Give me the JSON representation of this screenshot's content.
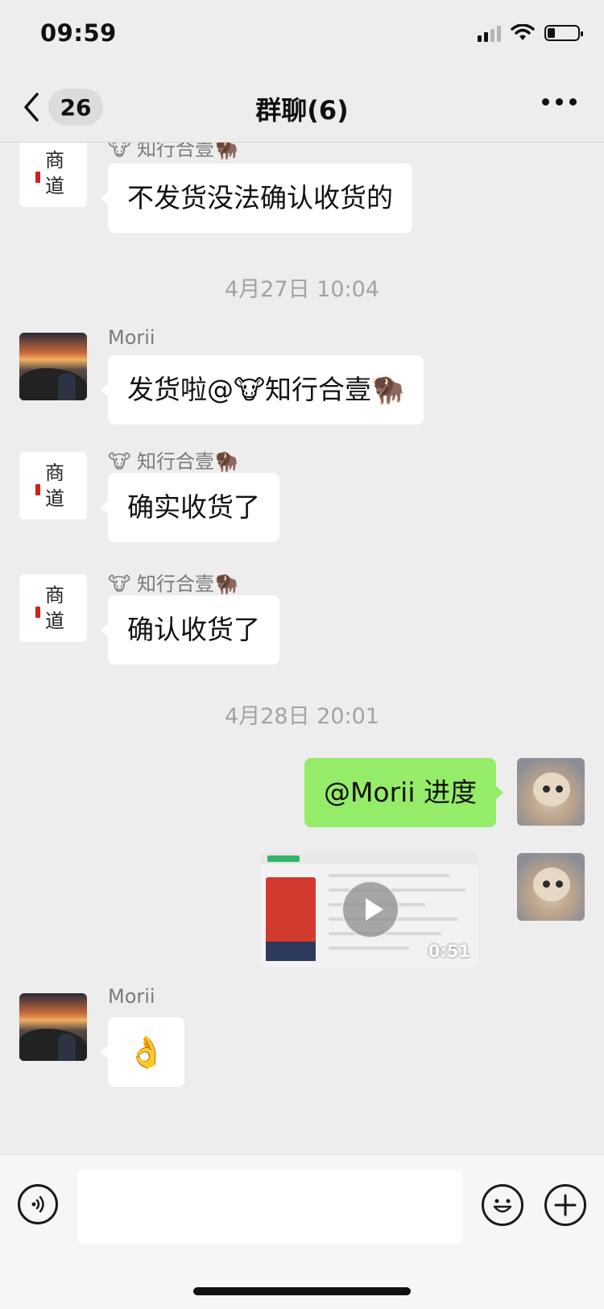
{
  "status_bar": {
    "time": "09:59",
    "battery_level": 0.25,
    "signal_bars": 2
  },
  "nav": {
    "back_badge": "26",
    "title": "群聊(6)"
  },
  "chat": {
    "messages": [
      {
        "sender": "🐮 知行合壹🦬",
        "text": "不发货没法确认收货的"
      },
      {
        "timestamp": "4月27日 10:04"
      },
      {
        "sender": "Morii",
        "text": "发货啦@🐮知行合壹🦬"
      },
      {
        "sender": "🐮 知行合壹🦬",
        "text": "确实收货了"
      },
      {
        "sender": "🐮 知行合壹🦬",
        "text": "确认收货了"
      },
      {
        "timestamp": "4月28日 20:01"
      },
      {
        "text": "@Morii 进度"
      },
      {
        "video_duration": "0:51"
      },
      {
        "sender": "Morii",
        "text": "👌"
      }
    ],
    "avatar_logo_text": "商道"
  },
  "input_bar": {
    "message_value": "",
    "placeholder": ""
  },
  "colors": {
    "self_bubble": "#95ec69",
    "other_bubble": "#ffffff",
    "background": "#ededed"
  },
  "icons": {
    "back": "chevron-left-icon",
    "more": "more-dots-icon",
    "voice": "voice-icon",
    "emoji": "emoji-icon",
    "plus": "plus-icon",
    "play": "play-icon"
  }
}
